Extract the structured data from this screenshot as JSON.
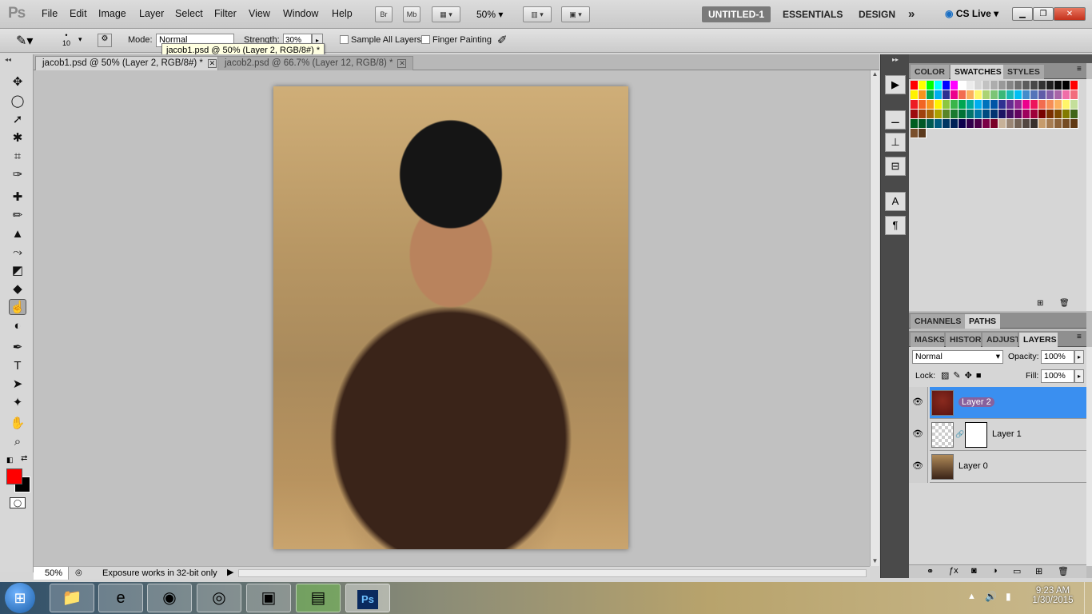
{
  "app": {
    "logo": "Ps"
  },
  "menu": [
    "File",
    "Edit",
    "Image",
    "Layer",
    "Select",
    "Filter",
    "View",
    "Window",
    "Help"
  ],
  "appbar": {
    "bridge": "Br",
    "minibridge": "Mb",
    "zoom": "50%",
    "workspace_untitled": "UNTITLED-1",
    "workspace_essentials": "ESSENTIALS",
    "workspace_design": "DESIGN",
    "more": "»",
    "cslive": "CS Live"
  },
  "options": {
    "brush_size": "10",
    "mode_label": "Mode:",
    "mode_value": "Normal",
    "strength_label": "Strength:",
    "strength_value": "30%",
    "sample_all": "Sample All Layers",
    "finger_painting": "Finger Painting",
    "tooltip": "jacob1.psd @ 50% (Layer 2, RGB/8#) *"
  },
  "tabs": [
    {
      "label": "jacob1.psd @ 50% (Layer 2, RGB/8#) *",
      "active": true
    },
    {
      "label": "jacob2.psd @ 66.7% (Layer 12, RGB/8) *",
      "active": false
    }
  ],
  "status": {
    "zoom": "50%",
    "message": "Exposure works in 32-bit only"
  },
  "panels": {
    "top_tabs": [
      "COLOR",
      "SWATCHES",
      "STYLES"
    ],
    "mid_tabs": [
      "CHANNELS",
      "PATHS"
    ],
    "layer_tabs": [
      "MASKS",
      "HISTOR",
      "ADJUST",
      "LAYERS"
    ],
    "blend_mode": "Normal",
    "opacity_label": "Opacity:",
    "opacity_value": "100%",
    "lock_label": "Lock:",
    "fill_label": "Fill:",
    "fill_value": "100%"
  },
  "layers": [
    {
      "name": "Layer 2",
      "selected": true
    },
    {
      "name": "Layer 1",
      "selected": false
    },
    {
      "name": "Layer 0",
      "selected": false
    }
  ],
  "swatch_colors": [
    [
      "#ff0000",
      "#ffff00",
      "#00ff00",
      "#00ffff",
      "#0000ff",
      "#ff00ff",
      "#ffffff",
      "#ebebeb",
      "#d6d6d6",
      "#c2c2c2",
      "#adadad",
      "#999999",
      "#858585",
      "#707070",
      "#5c5c5c",
      "#474747",
      "#333333",
      "#1f1f1f",
      "#0a0a0a",
      "#000000",
      "#ff0000"
    ],
    [
      "#fff200",
      "#f7941d",
      "#00a651",
      "#00aeef",
      "#2e3192",
      "#ec008c",
      "#f26c4f",
      "#fbaf5d",
      "#fff568",
      "#acd373",
      "#7cc576",
      "#3bb878",
      "#1abbb4",
      "#00bff3",
      "#438ccb",
      "#5574b9",
      "#605ca8",
      "#855fa8",
      "#a864a8",
      "#f06ea9",
      "#f26d7d"
    ],
    [
      "#ed1c24",
      "#f26522",
      "#f7941d",
      "#fff200",
      "#8dc63f",
      "#39b54a",
      "#00a651",
      "#00a99d",
      "#00aeef",
      "#0072bc",
      "#0054a6",
      "#2e3192",
      "#662d91",
      "#92278f",
      "#ec008c",
      "#ed145b",
      "#f26c4f",
      "#f68e56",
      "#fbaf5d",
      "#fff568",
      "#c4df9b"
    ],
    [
      "#9e0b0f",
      "#a0410d",
      "#a36209",
      "#aba000",
      "#598527",
      "#1a7b30",
      "#007236",
      "#00746b",
      "#0076a3",
      "#004b80",
      "#003471",
      "#1b1464",
      "#440e62",
      "#630460",
      "#9e005d",
      "#9e0039",
      "#790000",
      "#7b2e00",
      "#7d4900",
      "#827b00",
      "#406618"
    ],
    [
      "#005e20",
      "#005826",
      "#005952",
      "#005b7f",
      "#003663",
      "#002157",
      "#0d004c",
      "#32004b",
      "#4b0049",
      "#7b0046",
      "#7a0026",
      "#c7b299",
      "#998675",
      "#736357",
      "#534741",
      "#37302d",
      "#c69c6d",
      "#a67c52",
      "#8c6239",
      "#754c24",
      "#603913"
    ],
    [
      "#7a4f2b",
      "#5c3a1d"
    ]
  ],
  "taskbar": {
    "time": "9:23 AM",
    "date": "1/30/2015"
  }
}
